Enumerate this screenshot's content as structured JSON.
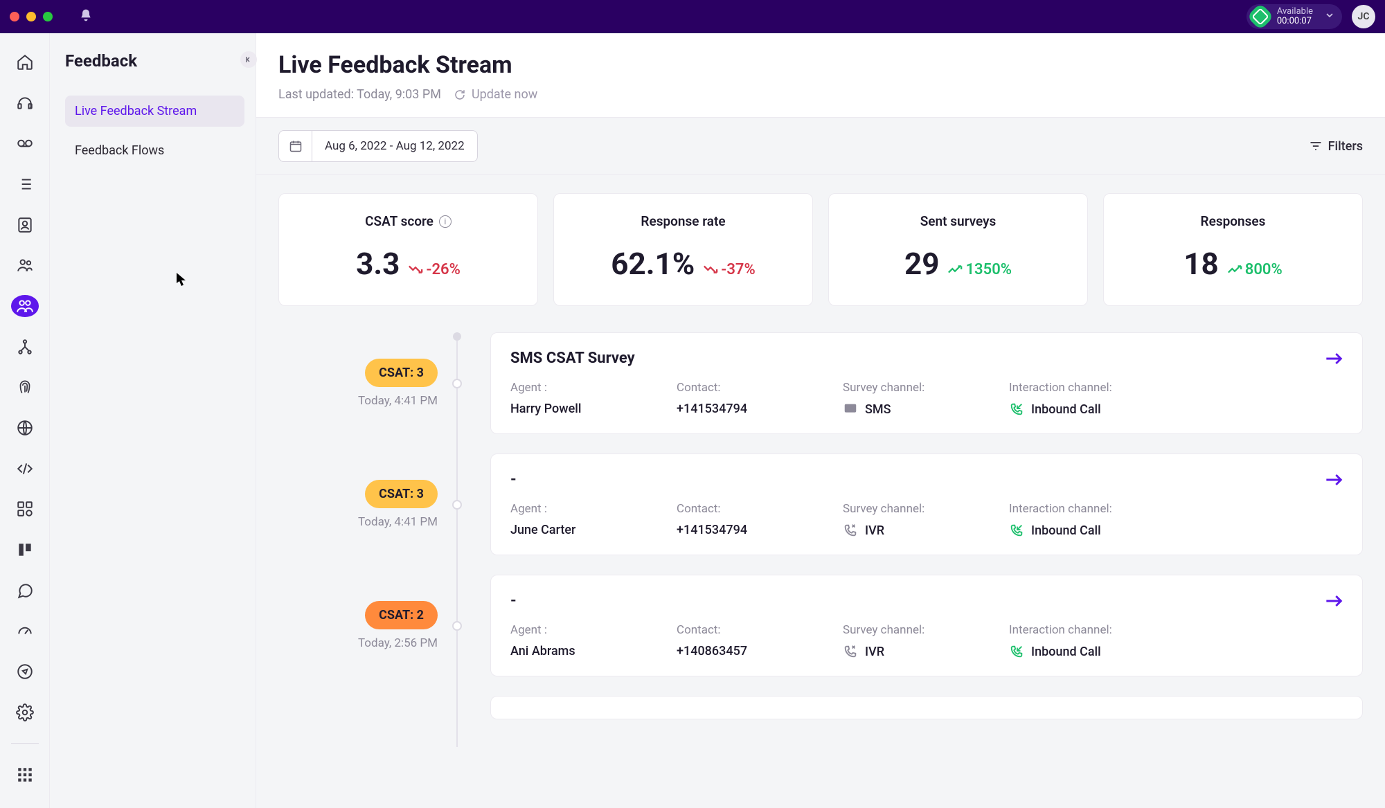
{
  "titlebar": {
    "status_label": "Available",
    "status_time": "00:00:07",
    "avatar_initials": "JC"
  },
  "subnav": {
    "title": "Feedback",
    "items": [
      {
        "label": "Live Feedback Stream",
        "active": true
      },
      {
        "label": "Feedback Flows",
        "active": false
      }
    ]
  },
  "header": {
    "title": "Live Feedback Stream",
    "last_updated": "Last updated: Today, 9:03 PM",
    "update_now": "Update now"
  },
  "toolbar": {
    "date_range": "Aug 6, 2022 - Aug 12, 2022",
    "filters_label": "Filters"
  },
  "kpis": [
    {
      "label": "CSAT score",
      "value": "3.3",
      "delta": "-26%",
      "dir": "neg",
      "info": true
    },
    {
      "label": "Response rate",
      "value": "62.1%",
      "delta": "-37%",
      "dir": "neg",
      "info": false
    },
    {
      "label": "Sent surveys",
      "value": "29",
      "delta": "1350%",
      "dir": "pos",
      "info": false
    },
    {
      "label": "Responses",
      "value": "18",
      "delta": "800%",
      "dir": "pos",
      "info": false
    }
  ],
  "feed": [
    {
      "csat_pill": "CSAT: 3",
      "pill_class": "csat3",
      "time": "Today, 4:41 PM",
      "title": "SMS CSAT Survey",
      "agent_label": "Agent :",
      "agent": "Harry Powell",
      "contact_label": "Contact:",
      "contact": "+141534794",
      "survey_channel_label": "Survey channel:",
      "survey_channel": "SMS",
      "survey_icon": "sms",
      "interaction_channel_label": "Interaction channel:",
      "interaction_channel": "Inbound Call"
    },
    {
      "csat_pill": "CSAT: 3",
      "pill_class": "csat3",
      "time": "Today, 4:41 PM",
      "title": "-",
      "agent_label": "Agent :",
      "agent": "June Carter",
      "contact_label": "Contact:",
      "contact": "+141534794",
      "survey_channel_label": "Survey channel:",
      "survey_channel": "IVR",
      "survey_icon": "ivr",
      "interaction_channel_label": "Interaction channel:",
      "interaction_channel": "Inbound Call"
    },
    {
      "csat_pill": "CSAT: 2",
      "pill_class": "csat2",
      "time": "Today, 2:56 PM",
      "title": "-",
      "agent_label": "Agent :",
      "agent": "Ani Abrams",
      "contact_label": "Contact:",
      "contact": "+140863457",
      "survey_channel_label": "Survey channel:",
      "survey_channel": "IVR",
      "survey_icon": "ivr",
      "interaction_channel_label": "Interaction channel:",
      "interaction_channel": "Inbound Call"
    }
  ]
}
